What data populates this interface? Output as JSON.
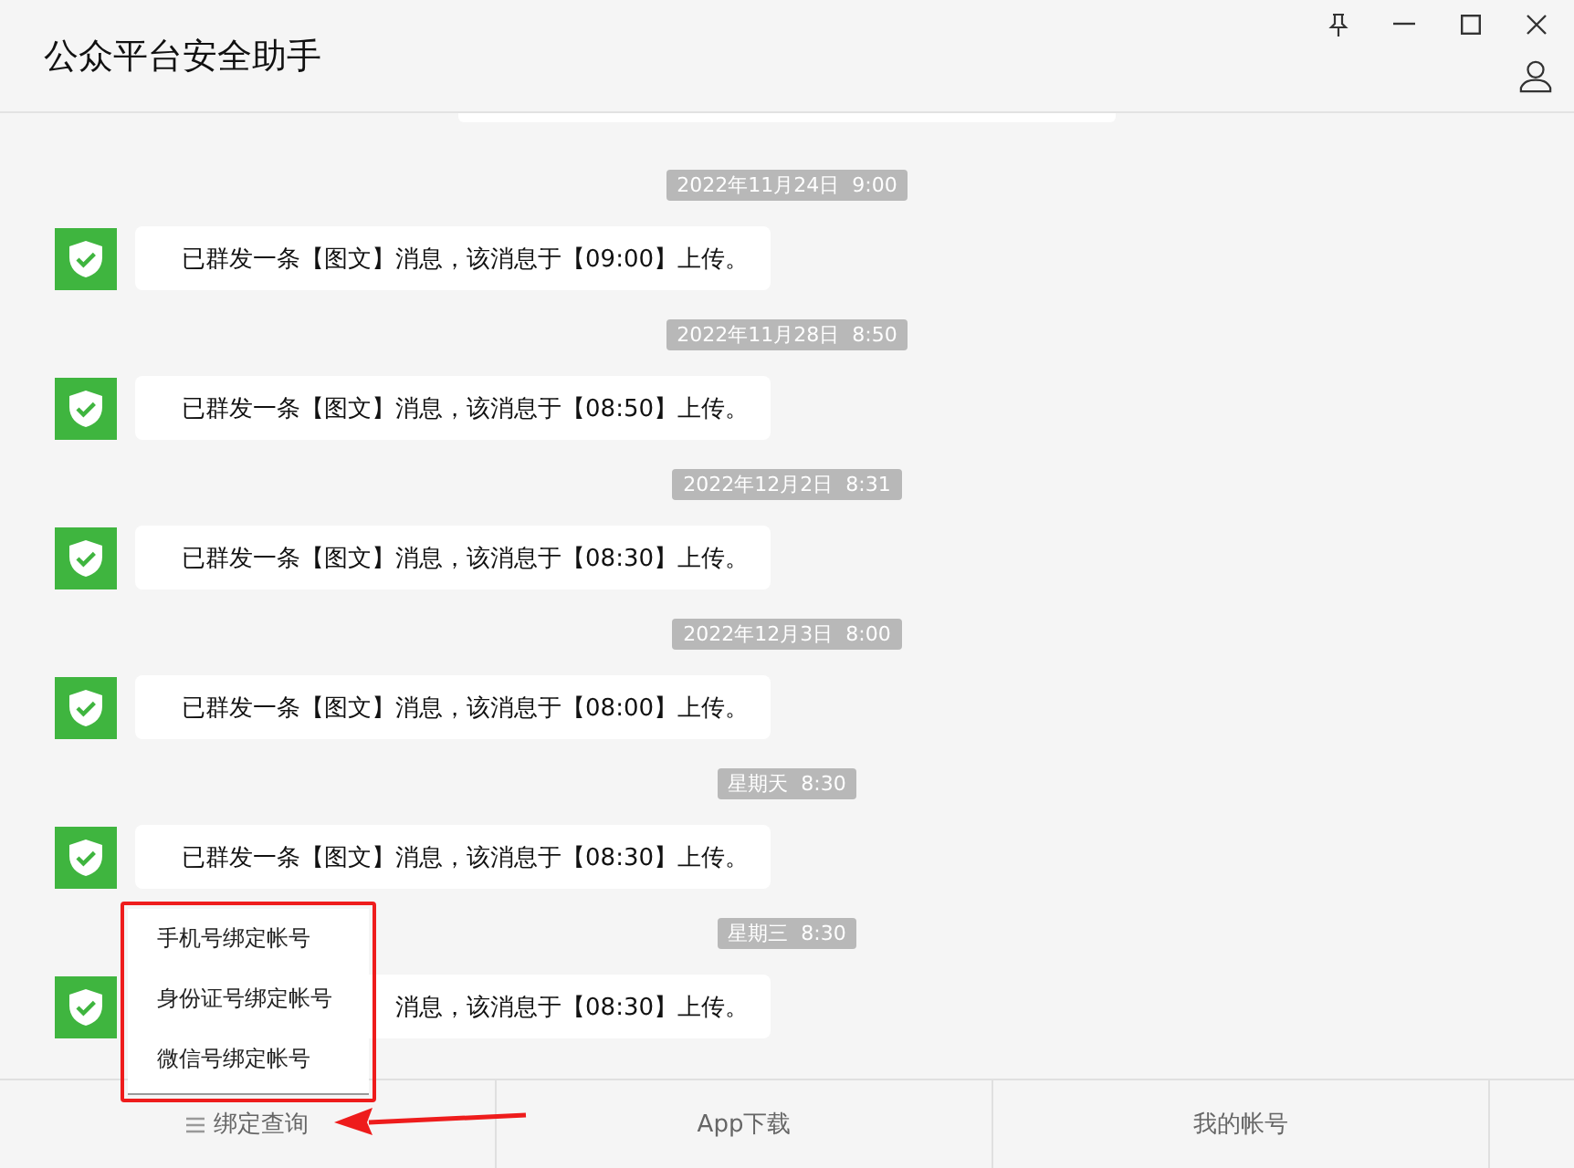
{
  "window": {
    "title": "公众平台安全助手"
  },
  "messages": [
    {
      "time": "2022年11月24日  9:00",
      "text": "已群发一条【图文】消息，该消息于【09:00】上传。"
    },
    {
      "time": "2022年11月28日  8:50",
      "text": "已群发一条【图文】消息，该消息于【08:50】上传。"
    },
    {
      "time": "2022年12月2日  8:31",
      "text": "已群发一条【图文】消息，该消息于【08:30】上传。"
    },
    {
      "time": "2022年12月3日  8:00",
      "text": "已群发一条【图文】消息，该消息于【08:00】上传。"
    },
    {
      "time": "星期天  8:30",
      "text": "已群发一条【图文】消息，该消息于【08:30】上传。"
    },
    {
      "time": "星期三  8:30",
      "text": "消息，该消息于【08:30】上传。"
    }
  ],
  "menu": {
    "items": [
      "手机号绑定帐号",
      "身份证号绑定帐号",
      "微信号绑定帐号"
    ]
  },
  "tabs": [
    {
      "label": "绑定查询",
      "kind": "menu"
    },
    {
      "label": "App下载",
      "kind": "plain"
    },
    {
      "label": "我的帐号",
      "kind": "plain"
    }
  ]
}
